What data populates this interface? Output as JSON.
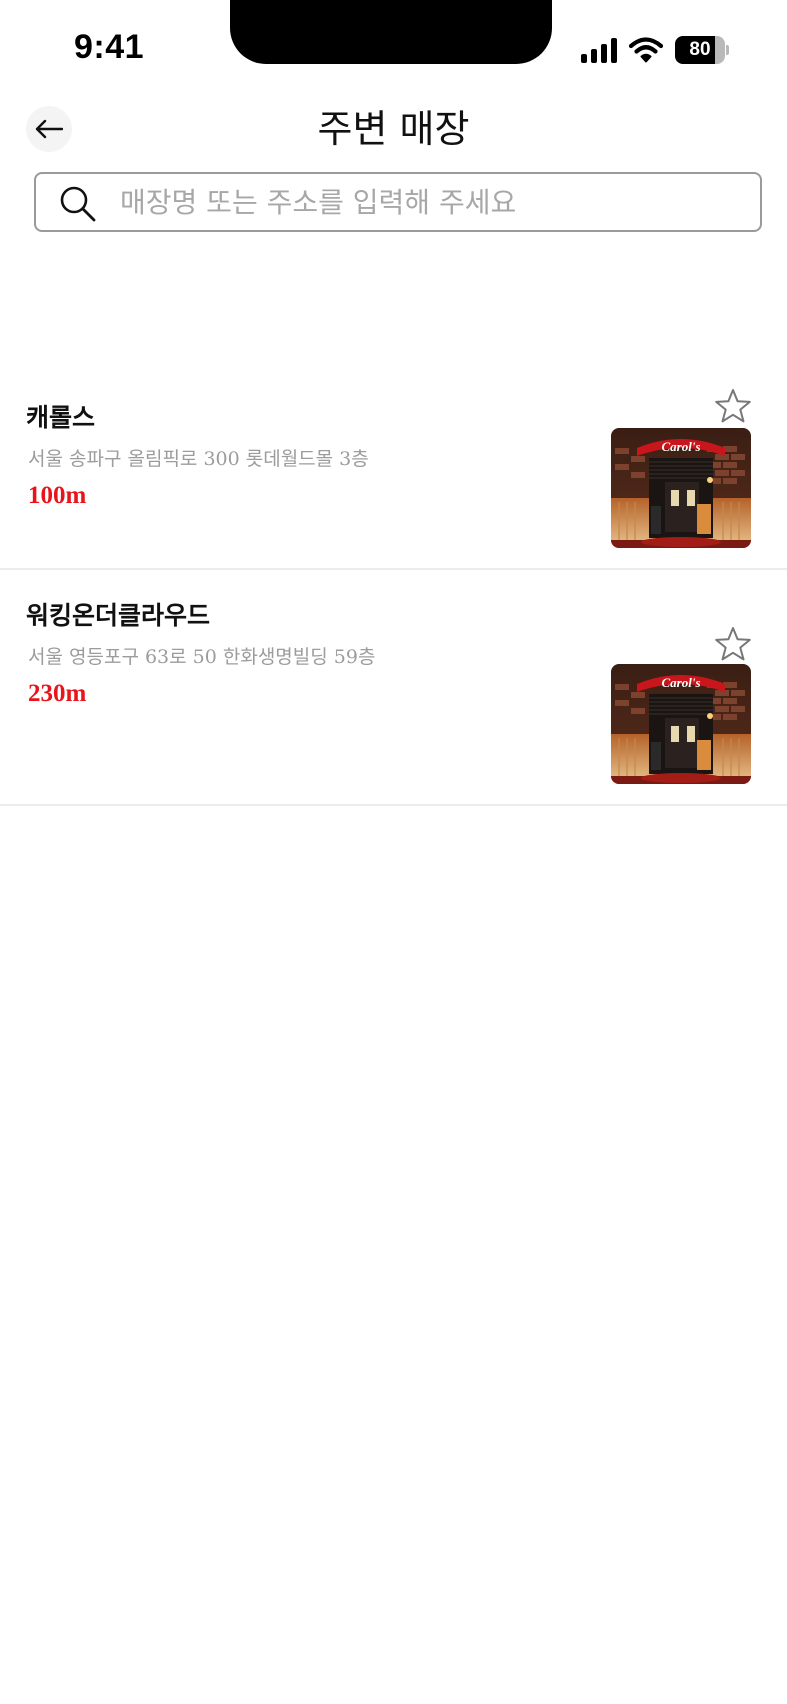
{
  "status_bar": {
    "time": "9:41",
    "battery_level": "80",
    "battery_fraction": 0.8
  },
  "header": {
    "title": "주변 매장",
    "back_icon": "arrow-left-icon"
  },
  "search": {
    "placeholder": "매장명 또는 주소를 입력해 주세요",
    "value": ""
  },
  "stores": [
    {
      "name": "캐롤스",
      "address": "서울 송파구 올림픽로 300 롯데월드몰 3층",
      "distance": "100m",
      "favorite_icon": "star-outline-icon",
      "thumbnail_sign": "Carol's"
    },
    {
      "name": "워킹온더클라우드",
      "address": "서울 영등포구 63로 50 한화생명빌딩 59층",
      "distance": "230m",
      "favorite_icon": "star-outline-icon",
      "thumbnail_sign": "Carol's"
    }
  ],
  "colors": {
    "distance": "#e8141b",
    "address": "#9c9c9c",
    "divider": "#ececec"
  }
}
